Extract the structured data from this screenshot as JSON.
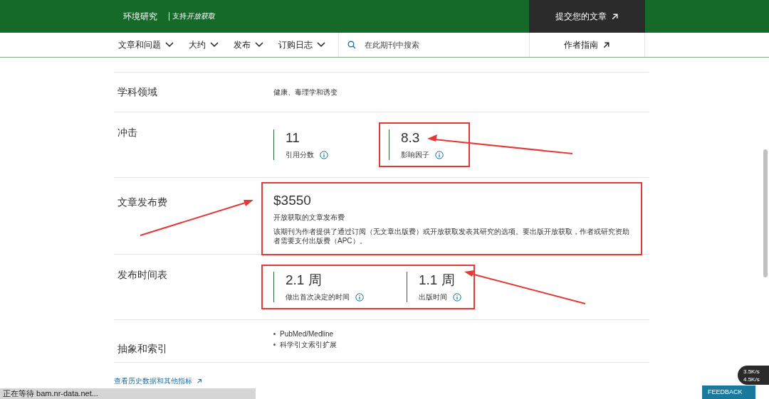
{
  "header": {
    "journal": "环境研究",
    "tagline": "支持",
    "tagline_emphasis": "开放获取",
    "submit": "提交您的文章"
  },
  "nav": {
    "items": [
      {
        "label": "文章和问题"
      },
      {
        "label": "大约"
      },
      {
        "label": "发布"
      },
      {
        "label": "订购日志"
      }
    ],
    "search": {
      "placeholder": "在此期刊中搜索"
    },
    "guide": "作者指南"
  },
  "sections": [
    {
      "kind": "text",
      "label": "学科领域",
      "value": "健康、毒理学和诱变"
    },
    {
      "kind": "metrics",
      "label": "冲击",
      "highlighted": false,
      "metrics": [
        {
          "value": "11",
          "caption": "引用分数",
          "highlighted": false
        },
        {
          "value": "8.3",
          "caption": "影响因子",
          "highlighted": true
        }
      ]
    },
    {
      "kind": "fee",
      "label": "文章发布费",
      "highlighted": true,
      "value": "$3550",
      "caption": "开放获取的文章发布费",
      "note": "该期刊为作者提供了通过订阅（无文章出版费）或开放获取发表其研究的选项。要出版开放获取，作者或研究资助者需要支付出版费（APC）。"
    },
    {
      "kind": "metrics",
      "label": "发布时间表",
      "highlighted": true,
      "metrics": [
        {
          "value": "2.1 周",
          "caption": "做出首次决定的时间",
          "highlighted": false
        },
        {
          "value": "1.1 周",
          "caption": "出版时间",
          "highlighted": false
        }
      ]
    },
    {
      "kind": "list",
      "label": "抽象和索引",
      "items": [
        "PubMed/Medline",
        "科学引文索引扩展"
      ]
    }
  ],
  "history_link": "查看历史数据和其他指标",
  "status_bar": "正在等待 bam.nr-data.net...",
  "feedback": "FEEDBACK",
  "speed": {
    "up": "3.5K/s",
    "down": "4.5K/s"
  }
}
